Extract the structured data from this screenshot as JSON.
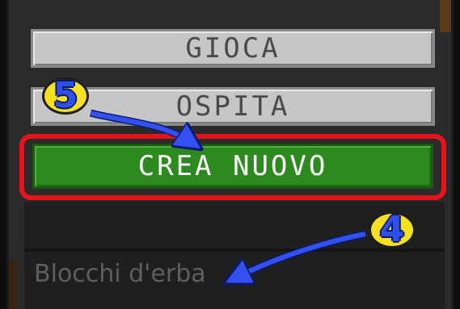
{
  "menu": {
    "play_label": "GIOCA",
    "host_label": "OSPITA",
    "create_label": "CREA NUOVO"
  },
  "world_list": {
    "first_item_name": "Blocchi d'erba"
  },
  "annotations": {
    "step_create": "5",
    "step_world": "4",
    "highlight_color": "#e8131a",
    "arrow_color": "#3350f0",
    "badge_color": "#f7e020"
  }
}
